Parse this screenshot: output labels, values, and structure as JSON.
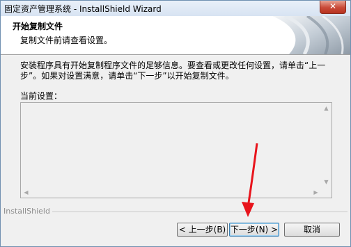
{
  "window": {
    "title": "固定资产管理系统 - InstallShield Wizard",
    "close_label": "✕"
  },
  "header": {
    "title": "开始复制文件",
    "subtitle": "复制文件前请查看设置。"
  },
  "description": "安装程序具有开始复制程序文件的足够信息。要查看或更改任何设置，请单击“上一步”。如果对设置满意，请单击“下一步”以开始复制文件。",
  "settings": {
    "label": "当前设置：",
    "content": ""
  },
  "footer": {
    "brand": "InstallShield"
  },
  "buttons": {
    "back": "< 上一步(B)",
    "next": "下一步(N) >",
    "cancel": "取消"
  },
  "colors": {
    "annotation_arrow": "#e8141c",
    "close_button": "#c94a38"
  }
}
